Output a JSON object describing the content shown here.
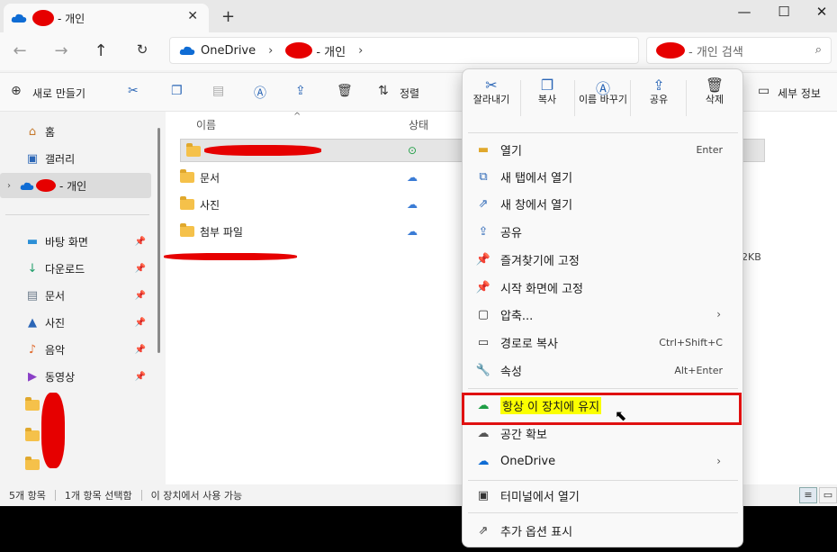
{
  "tab": {
    "title": "- 개인",
    "close": "✕",
    "add": "+"
  },
  "window_controls": {
    "minimize": "—",
    "maximize": "☐",
    "close": "✕"
  },
  "address": {
    "root": "OneDrive",
    "current": "- 개인",
    "sep": "›"
  },
  "search": {
    "placeholder": "- 개인 검색"
  },
  "toolbar": {
    "new": "새로 만들기",
    "sort": "정렬",
    "details": "세부 정보"
  },
  "sidebar": {
    "home": "홈",
    "gallery": "갤러리",
    "onedrive": "- 개인",
    "desktop": "바탕 화면",
    "downloads": "다운로드",
    "documents": "문서",
    "pictures": "사진",
    "music": "음악",
    "videos": "동영상"
  },
  "filelist": {
    "col_name": "이름",
    "col_status": "상태",
    "rows": [
      "문서",
      "사진",
      "첨부 파일"
    ],
    "size_text": "2KB"
  },
  "statusbar": {
    "count": "5개 항목",
    "selected": "1개 항목 선택함",
    "availability": "이 장치에서 사용 가능"
  },
  "context_menu": {
    "quick": {
      "cut": "잘라내기",
      "copy": "복사",
      "rename": "이름 바꾸기",
      "share": "공유",
      "delete": "삭제"
    },
    "items": {
      "open": "열기",
      "open_shortcut": "Enter",
      "open_new_tab": "새 탭에서 열기",
      "open_new_window": "새 창에서 열기",
      "share": "공유",
      "pin_quick": "즐겨찾기에 고정",
      "pin_start": "시작 화면에 고정",
      "compress": "압축...",
      "copy_path": "경로로 복사",
      "copy_path_shortcut": "Ctrl+Shift+C",
      "properties": "속성",
      "properties_shortcut": "Alt+Enter",
      "keep_on_device": "항상 이 장치에 유지",
      "free_space": "공간 확보",
      "onedrive": "OneDrive",
      "terminal": "터미널에서 열기",
      "more_options": "추가 옵션 표시"
    }
  },
  "colors": {
    "accent": "#2b66b6",
    "highlight": "#fbff00",
    "annotation_red": "#e01010"
  }
}
